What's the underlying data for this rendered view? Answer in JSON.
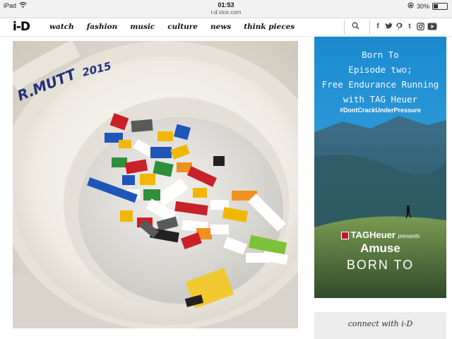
{
  "statusbar": {
    "device": "iPad",
    "time": "01:53",
    "url": "i-d.vice.com",
    "battery": "30%"
  },
  "nav": {
    "logo": "i-D",
    "links": [
      "watch",
      "fashion",
      "music",
      "culture",
      "news",
      "think pieces"
    ],
    "search_icon": "search-icon",
    "social_icons": [
      "facebook-icon",
      "twitter-icon",
      "pinterest-icon",
      "tumblr-icon",
      "instagram-icon",
      "youtube-icon"
    ]
  },
  "main": {
    "image_description": "toilet-bowl-with-lego-bricks",
    "bowl_writing": "R. MUTT 2015"
  },
  "ad": {
    "lines": [
      "Born To",
      "Episode two;",
      "Free Endurance Running",
      "with TAG Heuer"
    ],
    "hashtag": "#DontCrackUnderPressure",
    "brand": "TAGHeuer",
    "presents": "presents",
    "amuse": "Amuse",
    "born_to": "BORN TO"
  },
  "sidebar": {
    "connect": "connect with i-D"
  },
  "colors": {
    "ad_sky": "#1f8fd0",
    "ad_mountain": "#3a5f6a",
    "ad_grass": "#4f7a3a"
  }
}
